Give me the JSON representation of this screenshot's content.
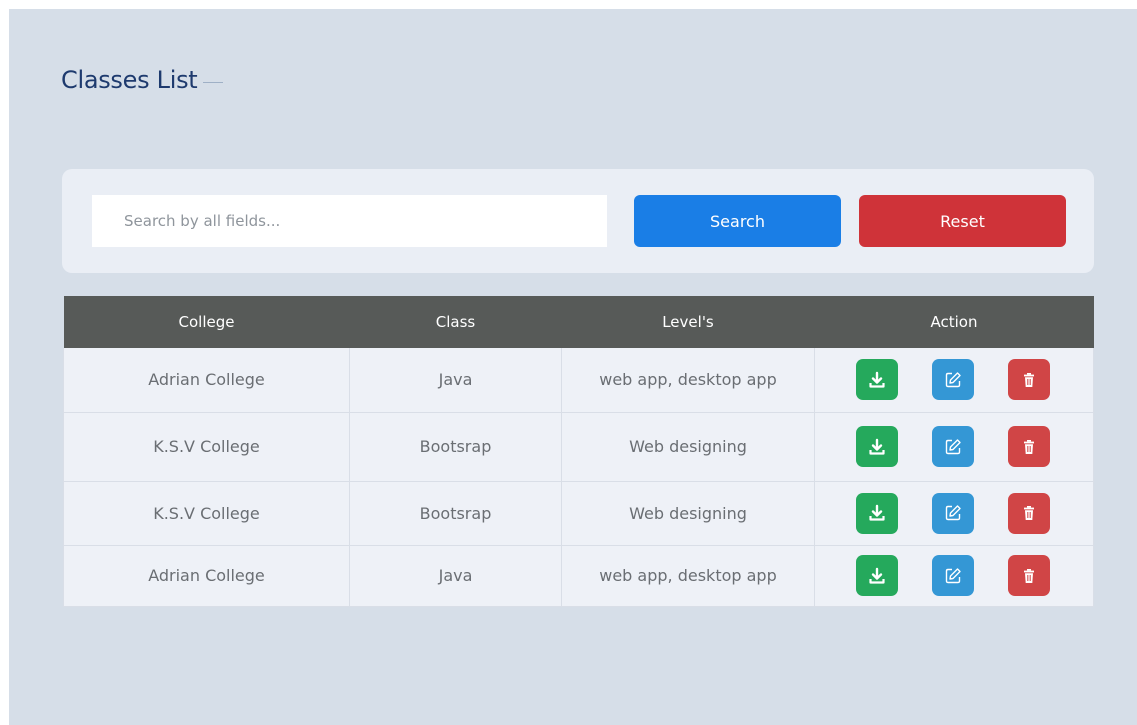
{
  "page": {
    "title": "Classes List"
  },
  "search": {
    "placeholder": "Search by all fields...",
    "value": ""
  },
  "buttons": {
    "search_label": "Search",
    "reset_label": "Reset"
  },
  "colors": {
    "search_button": "#1a7ee6",
    "reset_button": "#cf3339",
    "download": "#25a95c",
    "edit": "#3497d5",
    "delete": "#d04546",
    "table_header": "#575a58"
  },
  "table": {
    "columns": [
      "College",
      "Class",
      "Level's",
      "Action"
    ],
    "rows": [
      {
        "college": "Adrian College",
        "class": "Java",
        "levels": "web app, desktop app"
      },
      {
        "college": "K.S.V College",
        "class": "Bootsrap",
        "levels": "Web designing"
      },
      {
        "college": "K.S.V College",
        "class": "Bootsrap",
        "levels": "Web designing"
      },
      {
        "college": "Adrian College",
        "class": "Java",
        "levels": "web app, desktop app"
      }
    ],
    "row_actions": [
      "download-icon",
      "edit-icon",
      "trash-icon"
    ]
  }
}
